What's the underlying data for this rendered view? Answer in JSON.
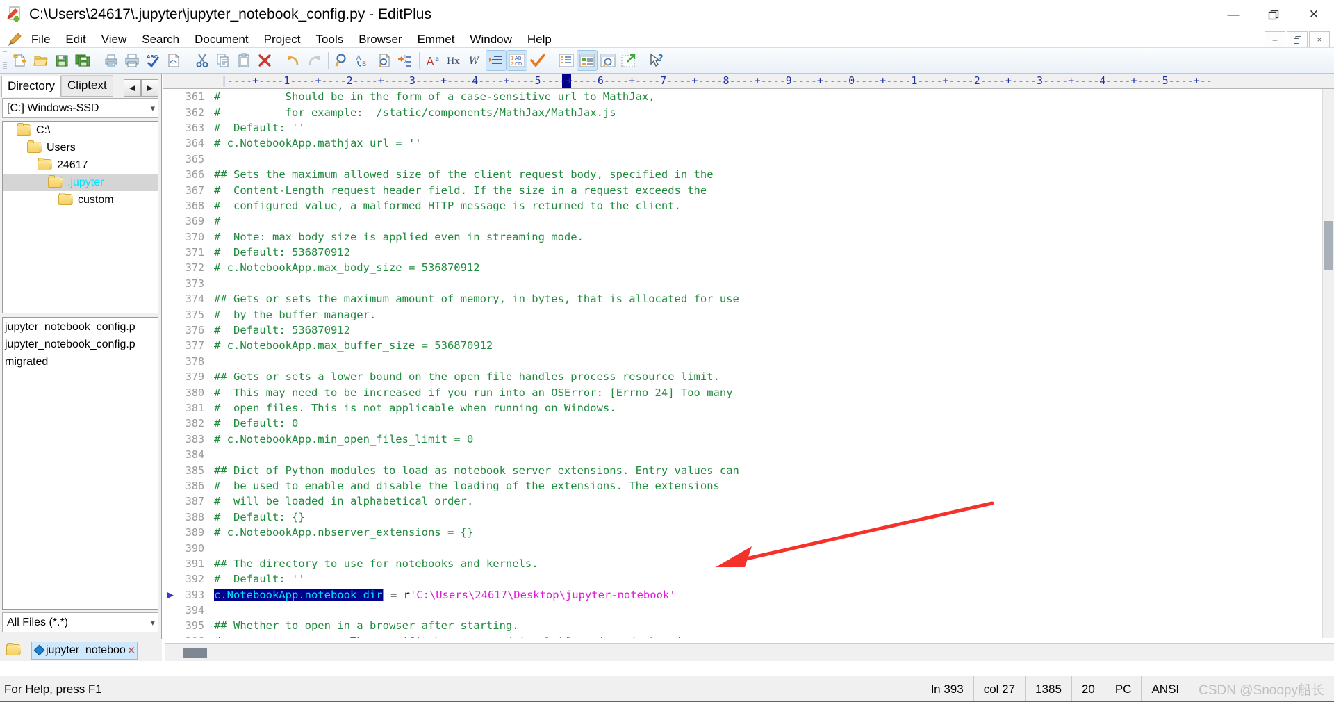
{
  "window": {
    "title": "C:\\Users\\24617\\.jupyter\\jupyter_notebook_config.py - EditPlus",
    "app_icon": "editplus-document-icon",
    "controls": {
      "minimize": "—",
      "restore": "❐",
      "close": "✕"
    }
  },
  "menu": {
    "pencil_icon": "pencil-icon",
    "items": [
      "File",
      "Edit",
      "View",
      "Search",
      "Document",
      "Project",
      "Tools",
      "Browser",
      "Emmet",
      "Window",
      "Help"
    ],
    "mdi": {
      "minimize": "–",
      "restore": "❐",
      "close": "×"
    }
  },
  "toolbar": {
    "groups": [
      [
        {
          "name": "new-file-icon",
          "label": "New"
        },
        {
          "name": "open-file-icon",
          "label": "Open"
        },
        {
          "name": "save-icon",
          "label": "Save"
        },
        {
          "name": "save-all-icon",
          "label": "Save All"
        }
      ],
      [
        {
          "name": "print-preview-icon",
          "label": "Print Preview"
        },
        {
          "name": "print-icon",
          "label": "Print"
        },
        {
          "name": "spell-check-icon",
          "label": "Spell Check"
        },
        {
          "name": "view-source-icon",
          "label": "View in Browser"
        }
      ],
      [
        {
          "name": "cut-icon",
          "label": "Cut"
        },
        {
          "name": "copy-icon",
          "label": "Copy"
        },
        {
          "name": "paste-icon",
          "label": "Paste"
        },
        {
          "name": "delete-icon",
          "label": "Delete"
        }
      ],
      [
        {
          "name": "undo-icon",
          "label": "Undo"
        },
        {
          "name": "redo-icon",
          "label": "Redo"
        }
      ],
      [
        {
          "name": "find-icon",
          "label": "Find"
        },
        {
          "name": "replace-icon",
          "label": "Replace"
        },
        {
          "name": "find-in-files-icon",
          "label": "Find in Files"
        },
        {
          "name": "goto-line-icon",
          "label": "Go to Line"
        }
      ],
      [
        {
          "name": "match-case-icon",
          "label": "Match Case"
        },
        {
          "name": "hex-viewer-icon",
          "label": "Hex Viewer"
        },
        {
          "name": "word-wrap-icon",
          "label": "Word Wrap"
        },
        {
          "name": "indent-icon",
          "label": "Indent",
          "active": true
        },
        {
          "name": "line-numbers-icon",
          "label": "Line Numbers",
          "active": true
        },
        {
          "name": "check-syntax-icon",
          "label": "Check Syntax"
        }
      ],
      [
        {
          "name": "document-selector-icon",
          "label": "Document Selector"
        },
        {
          "name": "toggle-directory-window-icon",
          "label": "Directory Window",
          "active": true
        },
        {
          "name": "browser-preview-icon",
          "label": "Preview"
        },
        {
          "name": "open-external-browser-icon",
          "label": "External Browser"
        }
      ],
      [
        {
          "name": "context-help-icon",
          "label": "Context Help"
        }
      ]
    ]
  },
  "sidebar": {
    "tabs": [
      {
        "label": "Directory",
        "active": true
      },
      {
        "label": "Cliptext",
        "active": false
      }
    ],
    "tab_arrows": {
      "prev": "◀",
      "next": "▶"
    },
    "drive": {
      "value": "[C:] Windows-SSD",
      "chevron": "chevron-down-icon"
    },
    "tree": [
      {
        "label": "C:\\",
        "depth": 0,
        "selected": false
      },
      {
        "label": "Users",
        "depth": 1,
        "selected": false
      },
      {
        "label": "24617",
        "depth": 2,
        "selected": false
      },
      {
        "label": ".jupyter",
        "depth": 3,
        "selected": true
      },
      {
        "label": "custom",
        "depth": 4,
        "selected": false
      }
    ],
    "files": [
      "jupyter_notebook_config.p",
      "jupyter_notebook_config.p",
      "migrated"
    ],
    "filter": {
      "value": "All Files (*.*)",
      "chevron": "chevron-down-icon"
    },
    "doc_tab": {
      "label": "jupyter_noteboo",
      "close": "✕",
      "folder_icon": "folder-icon",
      "file_icon": "diamond-icon"
    }
  },
  "editor": {
    "ruler": "|----+----1----+----2----+----3----+----4----+----5----+----6----+----7----+----8----+----9----+----0----+----1----+----2----+----3----+----4----+----5----+--",
    "caret_column_marker": "caret-column-marker",
    "lines": [
      {
        "n": "361",
        "segs": [
          {
            "t": "#          Should be in the form of a case-sensitive url to MathJax,",
            "c": "cmt"
          }
        ]
      },
      {
        "n": "362",
        "segs": [
          {
            "t": "#          for example:  /static/components/MathJax/MathJax.js",
            "c": "cmt"
          }
        ]
      },
      {
        "n": "363",
        "segs": [
          {
            "t": "#  Default: ''",
            "c": "cmt"
          }
        ]
      },
      {
        "n": "364",
        "segs": [
          {
            "t": "# c.NotebookApp.mathjax_url = ''",
            "c": "cmt"
          }
        ]
      },
      {
        "n": "365",
        "segs": [
          {
            "t": "",
            "c": "cmt"
          }
        ]
      },
      {
        "n": "366",
        "segs": [
          {
            "t": "## Sets the maximum allowed size of the client request body, specified in the",
            "c": "cmt"
          }
        ]
      },
      {
        "n": "367",
        "segs": [
          {
            "t": "#  Content-Length request header field. If the size in a request exceeds the",
            "c": "cmt"
          }
        ]
      },
      {
        "n": "368",
        "segs": [
          {
            "t": "#  configured value, a malformed HTTP message is returned to the client.",
            "c": "cmt"
          }
        ]
      },
      {
        "n": "369",
        "segs": [
          {
            "t": "#",
            "c": "cmt"
          }
        ]
      },
      {
        "n": "370",
        "segs": [
          {
            "t": "#  Note: max_body_size is applied even in streaming mode.",
            "c": "cmt"
          }
        ]
      },
      {
        "n": "371",
        "segs": [
          {
            "t": "#  Default: 536870912",
            "c": "cmt"
          }
        ]
      },
      {
        "n": "372",
        "segs": [
          {
            "t": "# c.NotebookApp.max_body_size = 536870912",
            "c": "cmt"
          }
        ]
      },
      {
        "n": "373",
        "segs": [
          {
            "t": "",
            "c": "cmt"
          }
        ]
      },
      {
        "n": "374",
        "segs": [
          {
            "t": "## Gets or sets the maximum amount of memory, in bytes, that is allocated for use",
            "c": "cmt"
          }
        ]
      },
      {
        "n": "375",
        "segs": [
          {
            "t": "#  by the buffer manager.",
            "c": "cmt"
          }
        ]
      },
      {
        "n": "376",
        "segs": [
          {
            "t": "#  Default: 536870912",
            "c": "cmt"
          }
        ]
      },
      {
        "n": "377",
        "segs": [
          {
            "t": "# c.NotebookApp.max_buffer_size = 536870912",
            "c": "cmt"
          }
        ]
      },
      {
        "n": "378",
        "segs": [
          {
            "t": "",
            "c": "cmt"
          }
        ]
      },
      {
        "n": "379",
        "segs": [
          {
            "t": "## Gets or sets a lower bound on the open file handles process resource limit.",
            "c": "cmt"
          }
        ]
      },
      {
        "n": "380",
        "segs": [
          {
            "t": "#  This may need to be increased if you run into an OSError: [Errno 24] Too many",
            "c": "cmt"
          }
        ]
      },
      {
        "n": "381",
        "segs": [
          {
            "t": "#  open files. This is not applicable when running on Windows.",
            "c": "cmt"
          }
        ]
      },
      {
        "n": "382",
        "segs": [
          {
            "t": "#  Default: 0",
            "c": "cmt"
          }
        ]
      },
      {
        "n": "383",
        "segs": [
          {
            "t": "# c.NotebookApp.min_open_files_limit = 0",
            "c": "cmt"
          }
        ]
      },
      {
        "n": "384",
        "segs": [
          {
            "t": "",
            "c": "cmt"
          }
        ]
      },
      {
        "n": "385",
        "segs": [
          {
            "t": "## Dict of Python modules to load as notebook server extensions. Entry values can",
            "c": "cmt"
          }
        ]
      },
      {
        "n": "386",
        "segs": [
          {
            "t": "#  be used to enable and disable the loading of the extensions. The extensions",
            "c": "cmt"
          }
        ]
      },
      {
        "n": "387",
        "segs": [
          {
            "t": "#  will be loaded in alphabetical order.",
            "c": "cmt"
          }
        ]
      },
      {
        "n": "388",
        "segs": [
          {
            "t": "#  Default: {}",
            "c": "cmt"
          }
        ]
      },
      {
        "n": "389",
        "segs": [
          {
            "t": "# c.NotebookApp.nbserver_extensions = {}",
            "c": "cmt"
          }
        ]
      },
      {
        "n": "390",
        "segs": [
          {
            "t": "",
            "c": "cmt"
          }
        ]
      },
      {
        "n": "391",
        "segs": [
          {
            "t": "## The directory to use for notebooks and kernels.",
            "c": "cmt"
          }
        ]
      },
      {
        "n": "392",
        "segs": [
          {
            "t": "#  Default: ''",
            "c": "cmt"
          }
        ]
      },
      {
        "n": "393",
        "marker": "▶",
        "segs": [
          {
            "t": "c.NotebookApp.notebook_dir",
            "c": "sel"
          },
          {
            "t": "caret",
            "c": "caret"
          },
          {
            "t": " = r",
            "c": "plain"
          },
          {
            "t": "'C:\\Users\\24617\\Desktop\\jupyter-notebook'",
            "c": "str"
          }
        ]
      },
      {
        "n": "394",
        "segs": [
          {
            "t": "",
            "c": "cmt"
          }
        ]
      },
      {
        "n": "395",
        "segs": [
          {
            "t": "## Whether to open in a browser after starting.",
            "c": "cmt"
          }
        ]
      },
      {
        "n": "396",
        "segs": [
          {
            "t": "#                    The specific browser used is platform dependent and",
            "c": "cmt"
          }
        ]
      }
    ]
  },
  "annotation": {
    "arrow_color": "#f5322a",
    "name": "red-pointer-arrow"
  },
  "statusbar": {
    "help_text": "For Help, press F1",
    "cells": [
      "ln 393",
      "col 27",
      "1385",
      "20",
      "PC",
      "ANSI"
    ],
    "watermark": "CSDN @Snoopy船长"
  },
  "colors": {
    "comment_green": "#1f8b3c",
    "string_magenta": "#e018d8",
    "selection_blue": "#00008b",
    "selection_text": "#00e5ff",
    "ruler_blue": "#1e2fa8",
    "accent": "#f5322a"
  }
}
